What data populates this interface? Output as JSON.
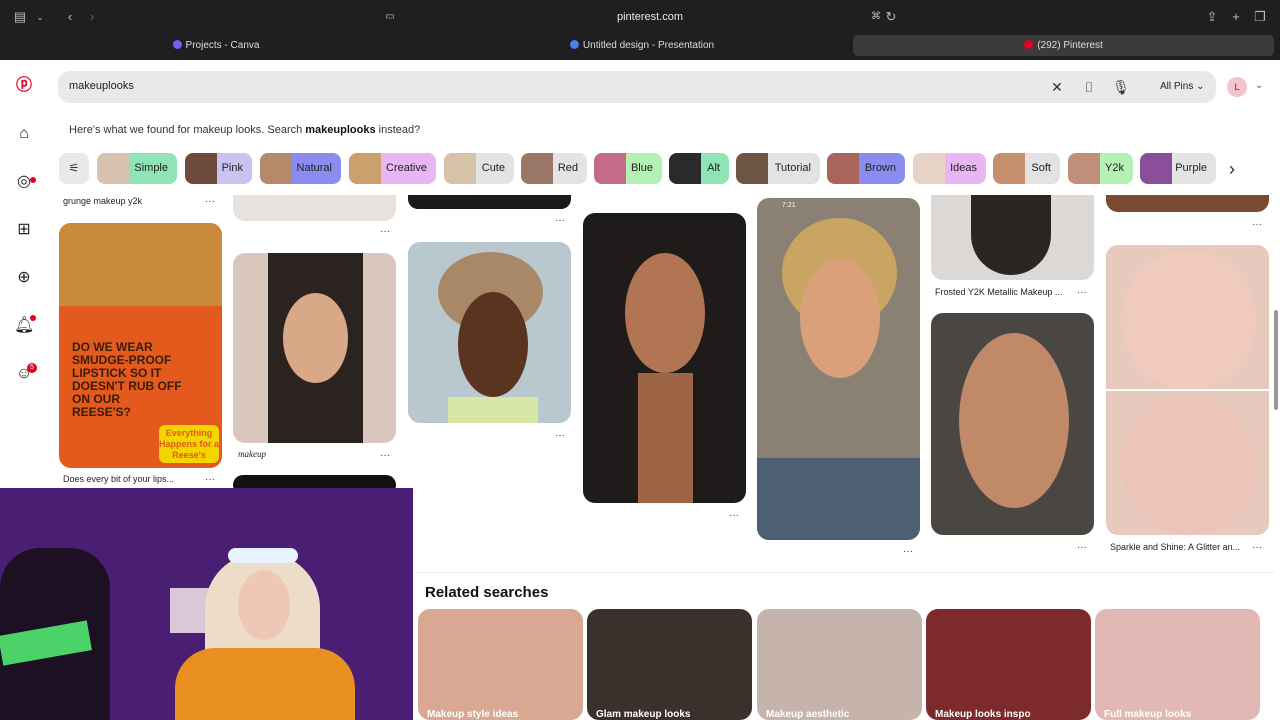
{
  "browser": {
    "url": "pinterest.com",
    "tabs": [
      {
        "label": "Projects - Canva",
        "favicon_color": "#7b5cf0"
      },
      {
        "label": "Untitled design - Presentation",
        "favicon_color": "#4c7cf0"
      },
      {
        "label": "(292) Pinterest",
        "favicon_color": "#e60023"
      }
    ]
  },
  "search": {
    "query": "makeuplooks",
    "scope": "All Pins",
    "avatar_initial": "L"
  },
  "notice": {
    "prefix": "Here's what we found for makeup looks. Search ",
    "link": "makeuplooks",
    "suffix": " instead?"
  },
  "chips": [
    {
      "label": "Simple",
      "color": "#8fe3b5"
    },
    {
      "label": "Pink",
      "color": "#c9c3f2"
    },
    {
      "label": "Natural",
      "color": "#8b8cf0"
    },
    {
      "label": "Creative",
      "color": "#e8b6f5"
    },
    {
      "label": "Cute",
      "color": "#e3e3e3"
    },
    {
      "label": "Red",
      "color": "#e3e3e3"
    },
    {
      "label": "Blue",
      "color": "#b5f0b5"
    },
    {
      "label": "Alt",
      "color": "#8fe3b5"
    },
    {
      "label": "Tutorial",
      "color": "#e3e3e3"
    },
    {
      "label": "Brown",
      "color": "#8b8cf0"
    },
    {
      "label": "Ideas",
      "color": "#e8b6f5"
    },
    {
      "label": "Soft",
      "color": "#e3e3e3"
    },
    {
      "label": "Y2k",
      "color": "#b5f0b5"
    },
    {
      "label": "Purple",
      "color": "#e3e3e3"
    }
  ],
  "pins": {
    "grunge_caption": "grunge makeup y2k",
    "reeses_text": "DO WE WEAR SMUDGE-PROOF LIPSTICK SO IT DOESN'T RUB OFF ON OUR REESE'S?",
    "reeses_brand": "Everything Happens for a Reese's",
    "reeses_caption": "Does every bit of your lips...",
    "makeup_caption": "makeup",
    "frosted_caption": "Frosted Y2K Metallic Makeup ...",
    "sparkle_caption": "Sparkle and Shine: A Glitter an...",
    "phone_time": "7:21"
  },
  "related": {
    "title": "Related searches",
    "items": [
      {
        "label": "Makeup style ideas"
      },
      {
        "label": "Glam makeup looks"
      },
      {
        "label": "Makeup aesthetic"
      },
      {
        "label": "Makeup looks inspo"
      },
      {
        "label": "Full makeup looks"
      }
    ]
  },
  "notifications": {
    "messages_badge": "5"
  }
}
